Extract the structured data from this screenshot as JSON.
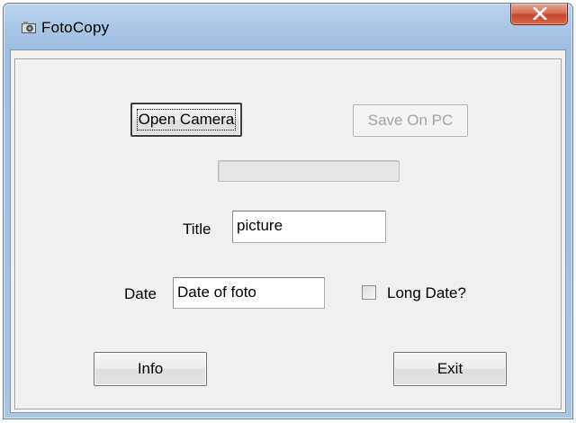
{
  "window": {
    "title": "FotoCopy",
    "app_icon": "camera-app-icon",
    "close_icon": "close-x-icon"
  },
  "buttons": {
    "open_camera": "Open Camera",
    "save_on_pc": "Save On PC",
    "info": "Info",
    "exit": "Exit"
  },
  "progress": {
    "value": 0
  },
  "fields": {
    "title_label": "Title",
    "title_value": "picture",
    "date_label": "Date",
    "date_value": "Date of foto",
    "long_date_label": "Long Date?",
    "long_date_checked": false
  },
  "colors": {
    "titlebar": "#a9c6e6",
    "close_button": "#c7462c",
    "client_bg": "#f0f0f0",
    "disabled_text": "#a3a3a3"
  }
}
